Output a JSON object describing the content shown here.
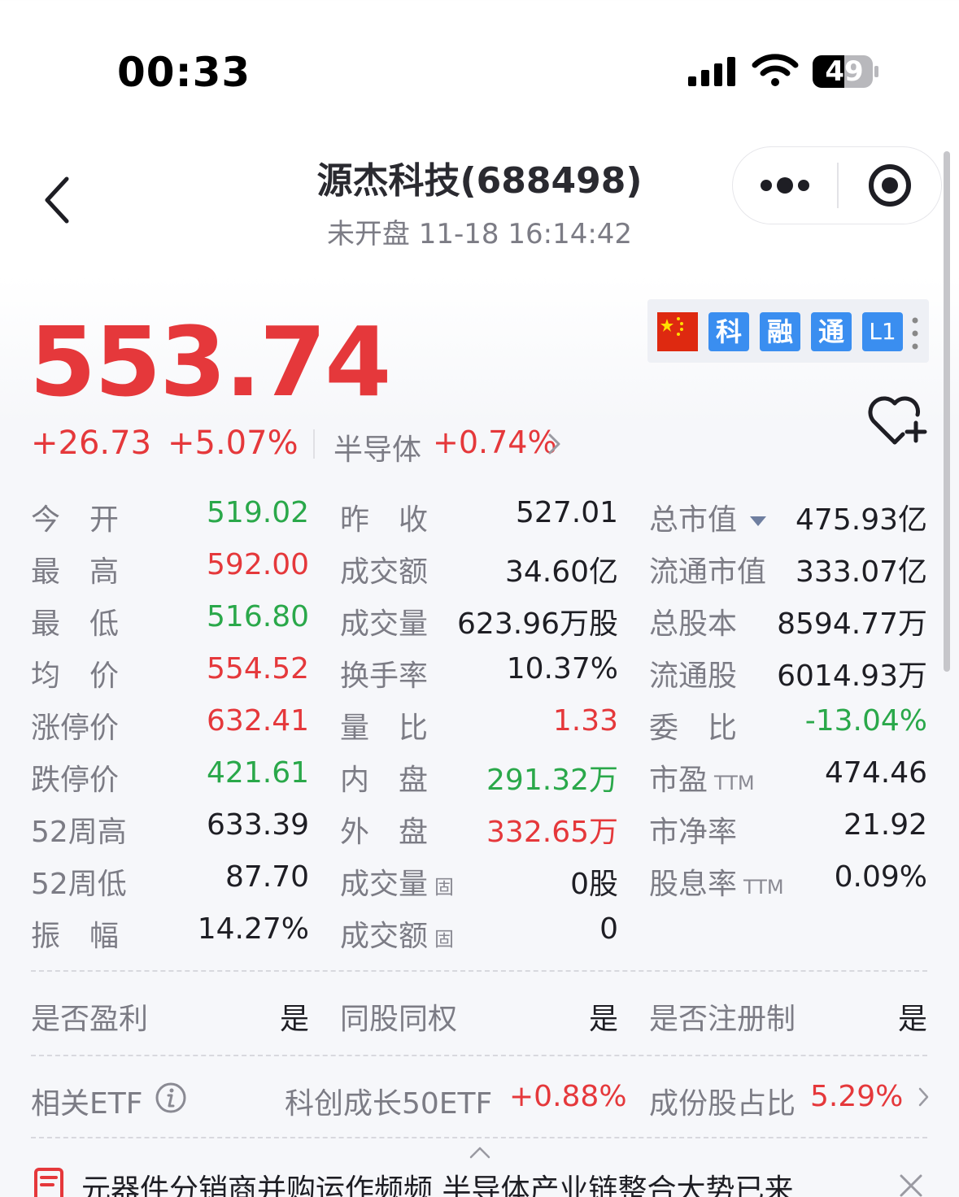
{
  "status_bar": {
    "time": "00:33",
    "battery": "49"
  },
  "header": {
    "title": "源杰科技(688498)",
    "subtitle": "未开盘  11-18 16:14:42"
  },
  "quote": {
    "price": "553.74",
    "change": "+26.73",
    "change_pct": "+5.07%",
    "sector": "半导体",
    "sector_change": "+0.74%",
    "badges": [
      "科",
      "融",
      "通",
      "L1"
    ]
  },
  "stats": {
    "col1": [
      {
        "label": "今　开",
        "value": "519.02"
      },
      {
        "label": "最　高",
        "value": "592.00"
      },
      {
        "label": "最　低",
        "value": "516.80"
      },
      {
        "label": "均　价",
        "value": "554.52"
      },
      {
        "label": "涨停价",
        "value": "632.41"
      },
      {
        "label": "跌停价",
        "value": "421.61"
      },
      {
        "label": "52周高",
        "value": "633.39"
      },
      {
        "label": "52周低",
        "value": "87.70"
      },
      {
        "label": "振　幅",
        "value": "14.27%"
      }
    ],
    "col2": [
      {
        "label": "昨　收",
        "value": "527.01"
      },
      {
        "label": "成交额",
        "value": "34.60亿"
      },
      {
        "label": "成交量",
        "value": "623.96万股"
      },
      {
        "label": "换手率",
        "value": "10.37%"
      },
      {
        "label": "量　比",
        "value": "1.33"
      },
      {
        "label": "内　盘",
        "value": "291.32万"
      },
      {
        "label": "外　盘",
        "value": "332.65万"
      },
      {
        "label": "成交量",
        "tag": "固",
        "value": "0股"
      },
      {
        "label": "成交额",
        "tag": "固",
        "value": "0"
      }
    ],
    "col3": [
      {
        "label": "总市值",
        "value": "475.93亿"
      },
      {
        "label": "流通市值",
        "value": "333.07亿"
      },
      {
        "label": "总股本",
        "value": "8594.77万"
      },
      {
        "label": "流通股",
        "value": "6014.93万"
      },
      {
        "label": "委　比",
        "value": "-13.04%"
      },
      {
        "label": "市盈",
        "tag": "TTM",
        "value": "474.46"
      },
      {
        "label": "市净率",
        "value": "21.92"
      },
      {
        "label": "股息率",
        "tag": "TTM",
        "value": "0.09%"
      }
    ]
  },
  "flags": [
    {
      "label": "是否盈利",
      "value": "是"
    },
    {
      "label": "同股同权",
      "value": "是"
    },
    {
      "label": "是否注册制",
      "value": "是"
    }
  ],
  "etf": {
    "label": "相关ETF",
    "name": "科创成长50ETF",
    "change": "+0.88%",
    "weight_label": "成份股占比",
    "weight": "5.29%"
  },
  "news": {
    "headline": "元器件分销商并购运作频频 半导体产业链整合大势已来"
  },
  "colors": {
    "up": "#e5383b",
    "down": "#2aa84a",
    "badge_blue": "#3a8ef0",
    "flag_red": "#de2910"
  }
}
